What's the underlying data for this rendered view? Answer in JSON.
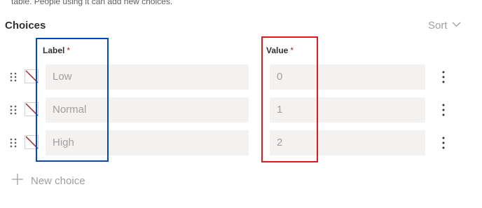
{
  "top_note": "table. People using it can add new choices.",
  "section": {
    "title": "Choices",
    "sort_label": "Sort"
  },
  "columns": {
    "label_header": "Label",
    "value_header": "Value",
    "required_mark": "*"
  },
  "choices": [
    {
      "label": "Low",
      "value": "0"
    },
    {
      "label": "Normal",
      "value": "1"
    },
    {
      "label": "High",
      "value": "2"
    }
  ],
  "new_choice_label": "New choice",
  "colors": {
    "field_bg": "#f3f2f1",
    "placeholder_text": "#a19f9d",
    "required": "#a4262c",
    "highlight_blue": "#0047cc",
    "highlight_red": "#e0181f"
  },
  "icons": [
    "drag-handle-icon",
    "no-color-swatch-icon",
    "more-options-icon",
    "chevron-down-icon",
    "plus-icon"
  ]
}
